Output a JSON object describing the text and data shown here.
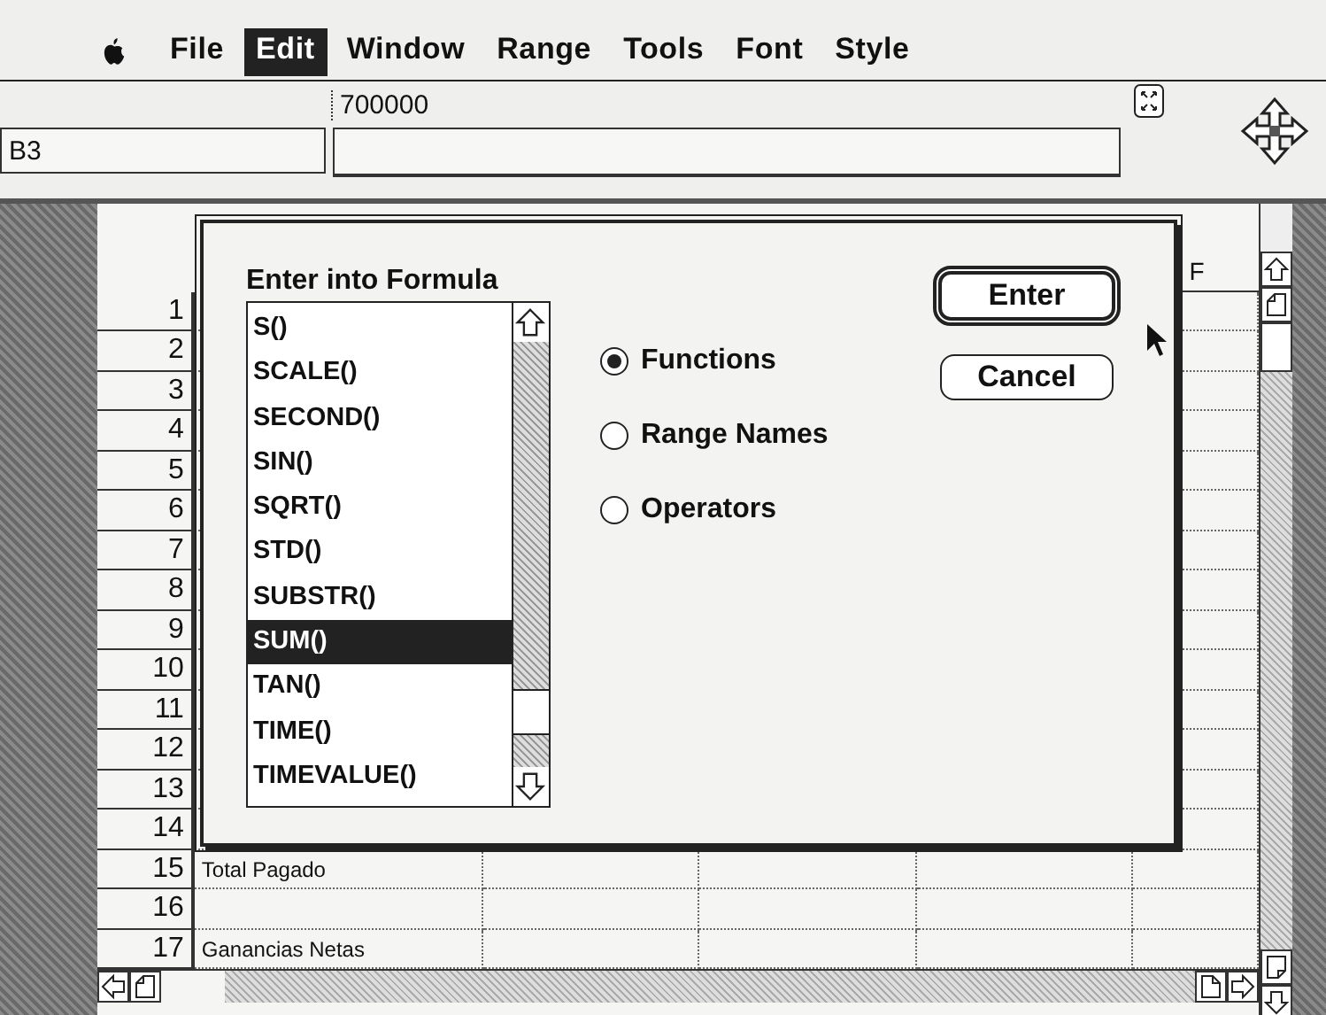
{
  "menu_bar": {
    "items": [
      {
        "label": "File",
        "selected": false
      },
      {
        "label": "Edit",
        "selected": true
      },
      {
        "label": "Window",
        "selected": false
      },
      {
        "label": "Range",
        "selected": false
      },
      {
        "label": "Tools",
        "selected": false
      },
      {
        "label": "Font",
        "selected": false
      },
      {
        "label": "Style",
        "selected": false
      }
    ]
  },
  "formula_bar": {
    "contents": "700000",
    "cell_reference": "B3"
  },
  "spreadsheet": {
    "columns": [
      "F"
    ],
    "rows": [
      {
        "number": "1"
      },
      {
        "number": "2"
      },
      {
        "number": "3"
      },
      {
        "number": "4"
      },
      {
        "number": "5"
      },
      {
        "number": "6"
      },
      {
        "number": "7"
      },
      {
        "number": "8"
      },
      {
        "number": "9"
      },
      {
        "number": "10"
      },
      {
        "number": "11"
      },
      {
        "number": "12"
      },
      {
        "number": "13"
      },
      {
        "number": "14"
      },
      {
        "number": "15",
        "label": "Total Pagado"
      },
      {
        "number": "16"
      },
      {
        "number": "17",
        "label": "Ganancias Netas"
      }
    ]
  },
  "dialog": {
    "title": "Enter into Formula",
    "list": {
      "items": [
        {
          "label": "S()",
          "selected": false
        },
        {
          "label": "SCALE()",
          "selected": false
        },
        {
          "label": "SECOND()",
          "selected": false
        },
        {
          "label": "SIN()",
          "selected": false
        },
        {
          "label": "SQRT()",
          "selected": false
        },
        {
          "label": "STD()",
          "selected": false
        },
        {
          "label": "SUBSTR()",
          "selected": false
        },
        {
          "label": "SUM()",
          "selected": true
        },
        {
          "label": "TAN()",
          "selected": false
        },
        {
          "label": "TIME()",
          "selected": false
        },
        {
          "label": "TIMEVALUE()",
          "selected": false
        }
      ]
    },
    "options": [
      {
        "label": "Functions",
        "selected": true
      },
      {
        "label": "Range Names",
        "selected": false
      },
      {
        "label": "Operators",
        "selected": false
      }
    ],
    "buttons": [
      {
        "label": "Enter",
        "kind": "default"
      },
      {
        "label": "Cancel",
        "kind": "normal"
      }
    ]
  }
}
